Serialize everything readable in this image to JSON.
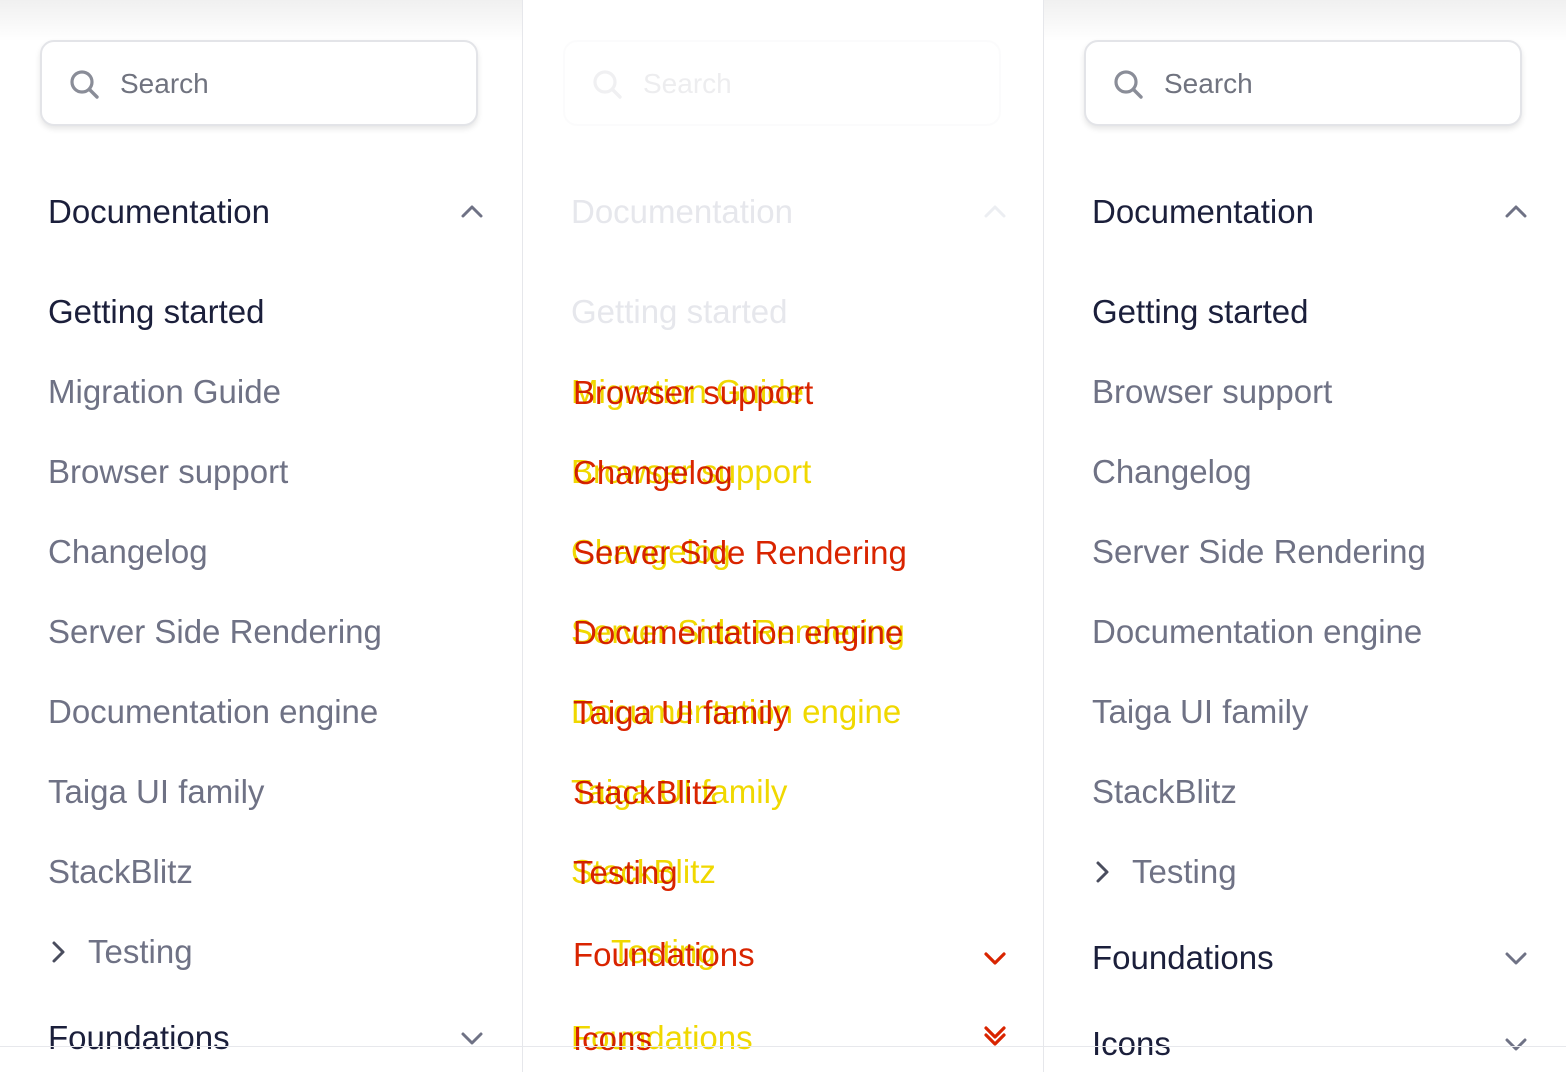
{
  "search": {
    "placeholder": "Search"
  },
  "left": {
    "section_title": "Documentation",
    "items": [
      "Getting started",
      "Migration Guide",
      "Browser support",
      "Changelog",
      "Server Side Rendering",
      "Documentation engine",
      "Taiga UI family",
      "StackBlitz"
    ],
    "subgroup": "Testing",
    "next_section": "Foundations"
  },
  "middle": {
    "section_title": "Documentation",
    "first_item": "Getting started",
    "overlaps": [
      [
        "Migration Guide",
        "Browser support"
      ],
      [
        "Browser support",
        "Changelog"
      ],
      [
        "Changelog",
        "Server Side Rendering"
      ],
      [
        "Server Side Rendering",
        "Documentation engine"
      ],
      [
        "Documentation engine",
        "Taiga UI family"
      ],
      [
        "Taiga UI family",
        "StackBlitz"
      ],
      [
        "StackBlitz",
        "Testing"
      ],
      [
        "Testing",
        "Foundations"
      ],
      [
        "Foundations",
        "Icons"
      ]
    ]
  },
  "right": {
    "section_title": "Documentation",
    "items": [
      "Getting started",
      "Browser support",
      "Changelog",
      "Server Side Rendering",
      "Documentation engine",
      "Taiga UI family",
      "StackBlitz"
    ],
    "subgroup": "Testing",
    "next_section": "Foundations",
    "last_section": "Icons"
  },
  "colors": {
    "heading": "#1b1f3b",
    "item": "#6f7285",
    "diff_red": "#d92400",
    "diff_yellow": "#f0d800"
  }
}
